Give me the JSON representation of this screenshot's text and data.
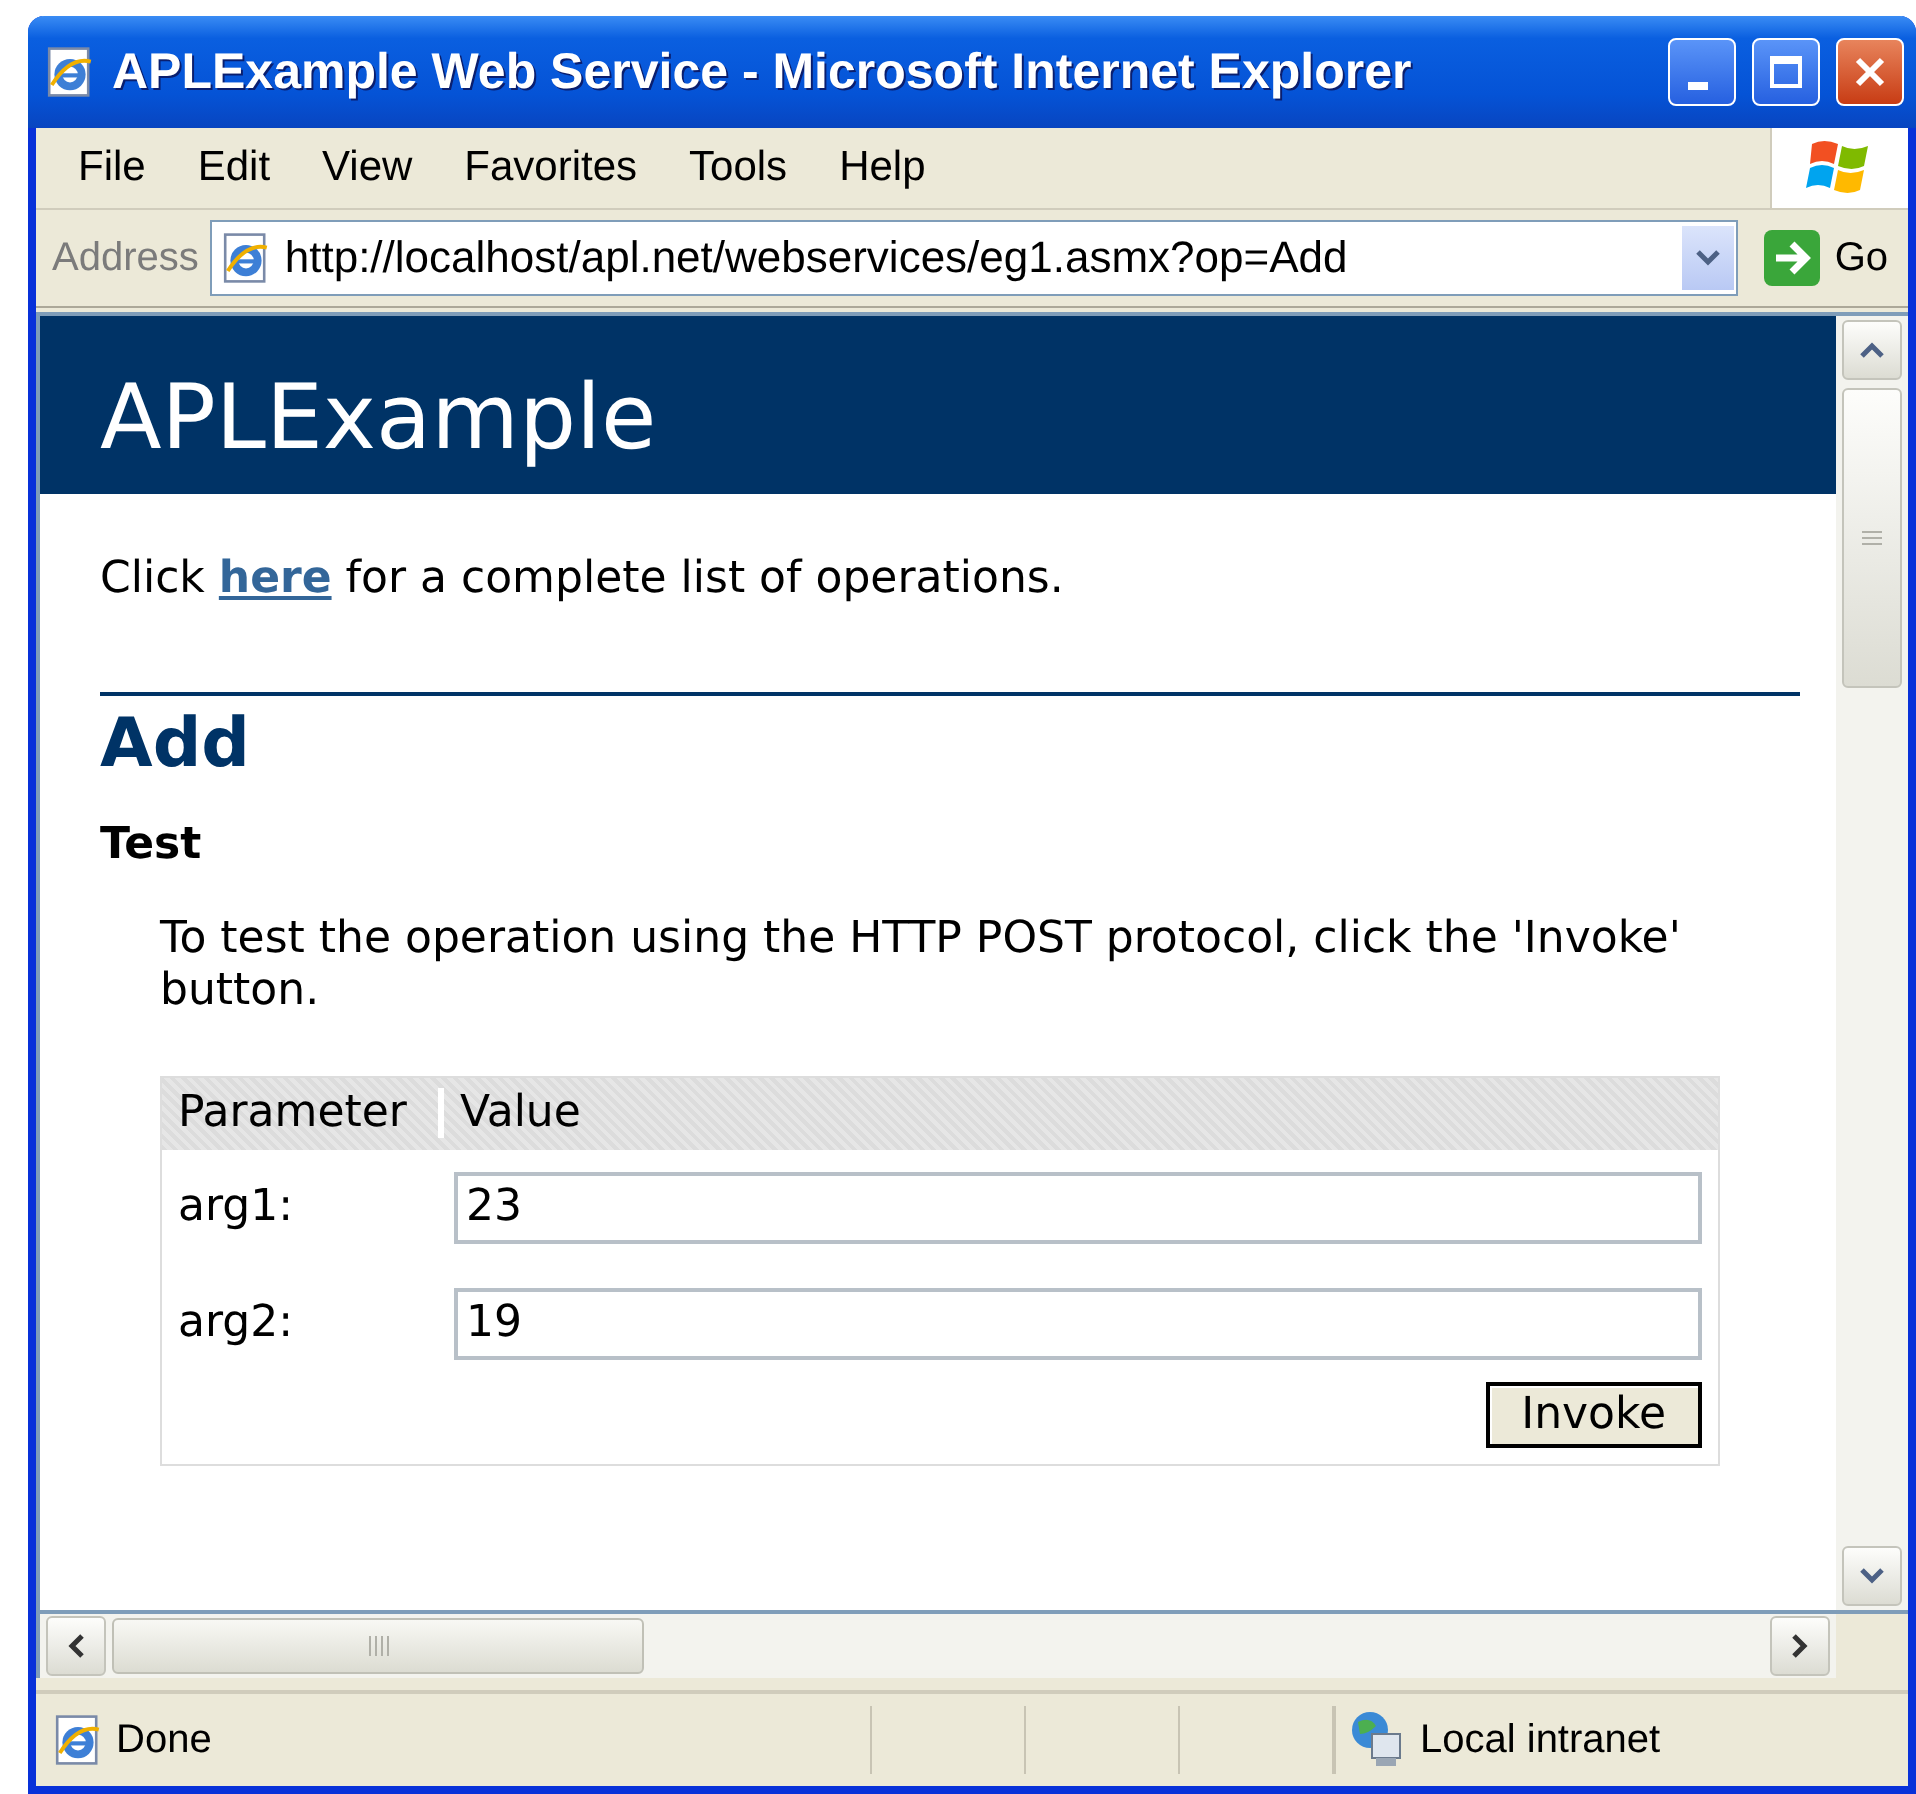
{
  "window": {
    "title": "APLExample Web Service - Microsoft Internet Explorer"
  },
  "menu": [
    {
      "label": "File"
    },
    {
      "label": "Edit"
    },
    {
      "label": "View"
    },
    {
      "label": "Favorites"
    },
    {
      "label": "Tools"
    },
    {
      "label": "Help"
    }
  ],
  "address_bar": {
    "label": "Address",
    "value": "http://localhost/apl.net/webservices/eg1.asmx?op=Add",
    "go": "Go"
  },
  "page": {
    "banner": "APLExample",
    "intro": {
      "before": "Click",
      "link": "here",
      "after": "for a complete list of operations."
    },
    "heading": "Add",
    "subheading": "Test",
    "instructions": "To test the operation using the HTTP POST protocol, click the 'Invoke' button.",
    "table": {
      "columns": [
        "Parameter",
        "Value"
      ],
      "rows": [
        {
          "label": "arg1:",
          "value": "23"
        },
        {
          "label": "arg2:",
          "value": "19"
        }
      ],
      "button": "Invoke"
    }
  },
  "status_bar": {
    "status": "Done",
    "zone": "Local intranet"
  }
}
